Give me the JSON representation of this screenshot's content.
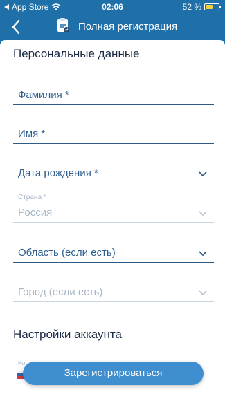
{
  "status_bar": {
    "back_app": "App Store",
    "time": "02:06",
    "battery": "52 %"
  },
  "nav": {
    "title": "Полная регистрация",
    "icons": {
      "back": "chevron-left-icon",
      "logo": "registration-logo-icon"
    }
  },
  "personal": {
    "title": "Персональные данные",
    "fields": {
      "surname": "Фамилия *",
      "name": "Имя *",
      "birthdate": "Дата рождения *",
      "country_label": "Страна *",
      "country_value": "Россия",
      "region": "Область (если есть)",
      "city": "Город (если есть)"
    }
  },
  "account": {
    "title": "Настройки аккаунта",
    "partial_label": "Ко"
  },
  "register_button": "Зарегистрироваться",
  "colors": {
    "brand": "#1f6fa8",
    "accent_button": "#3f8fd0",
    "field_line": "#2d5c86",
    "disabled": "#a7b6c7"
  }
}
